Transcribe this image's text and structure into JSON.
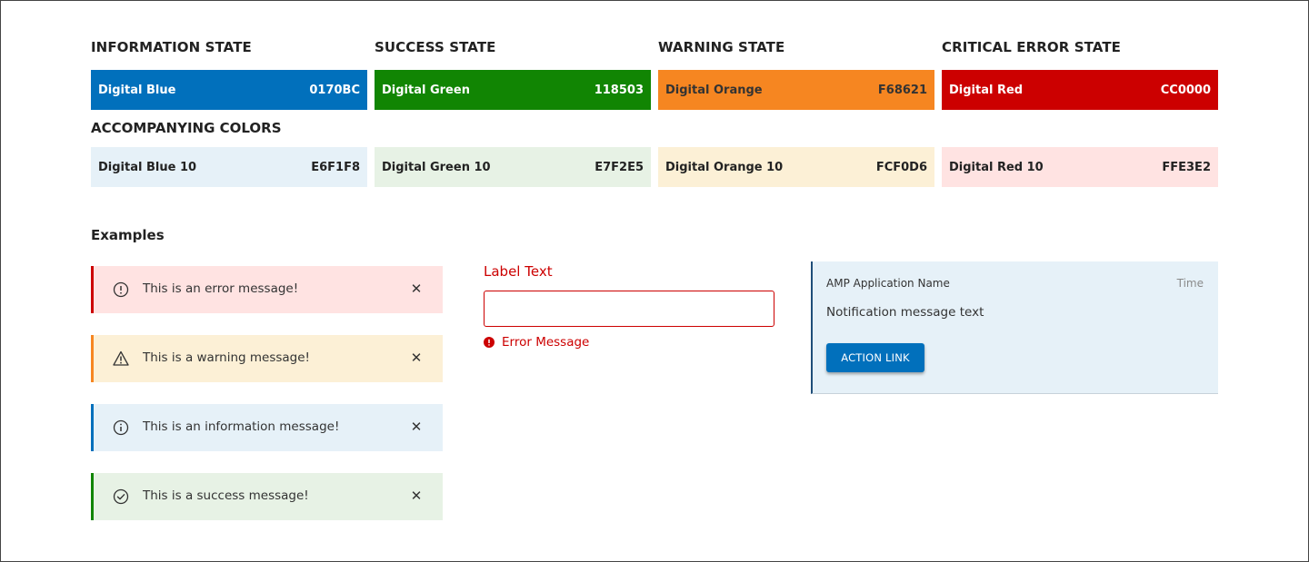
{
  "states": [
    {
      "title": "INFORMATION STATE",
      "name": "Digital Blue",
      "hex": "0170BC",
      "color": "#0170BC"
    },
    {
      "title": "SUCCESS STATE",
      "name": "Digital Green",
      "hex": "118503",
      "color": "#118503"
    },
    {
      "title": "WARNING STATE",
      "name": "Digital Orange",
      "hex": "F68621",
      "color": "#F68621"
    },
    {
      "title": "CRITICAL ERROR STATE",
      "name": "Digital Red",
      "hex": "CC0000",
      "color": "#CC0000"
    }
  ],
  "accompanying": {
    "title": "ACCOMPANYING COLORS",
    "colors": [
      {
        "name": "Digital Blue 10",
        "hex": "E6F1F8",
        "color": "#E6F1F8"
      },
      {
        "name": "Digital Green 10",
        "hex": "E7F2E5",
        "color": "#E7F2E5"
      },
      {
        "name": "Digital Orange 10",
        "hex": "FCF0D6",
        "color": "#FCF0D6"
      },
      {
        "name": "Digital Red 10",
        "hex": "FFE3E2",
        "color": "#FFE3E2"
      }
    ]
  },
  "examples": {
    "title": "Examples",
    "alerts": [
      {
        "type": "error",
        "icon": "exclamation-circle-icon",
        "text": "This is an error message!",
        "bg": "#FFE3E2",
        "bar": "#CC0000"
      },
      {
        "type": "warning",
        "icon": "warning-triangle-icon",
        "text": "This is a warning message!",
        "bg": "#FCF0D6",
        "bar": "#F68621"
      },
      {
        "type": "info",
        "icon": "info-circle-icon",
        "text": "This is an information message!",
        "bg": "#E6F1F8",
        "bar": "#0170BC"
      },
      {
        "type": "success",
        "icon": "check-circle-icon",
        "text": "This is a success message!",
        "bg": "#E7F2E5",
        "bar": "#118503"
      }
    ],
    "close_glyph": "✕",
    "field": {
      "label": "Label Text",
      "value": "",
      "error": "Error Message"
    },
    "notification": {
      "app_name": "AMP Application Name",
      "time": "Time",
      "message": "Notification message text",
      "action": "ACTION LINK"
    }
  }
}
